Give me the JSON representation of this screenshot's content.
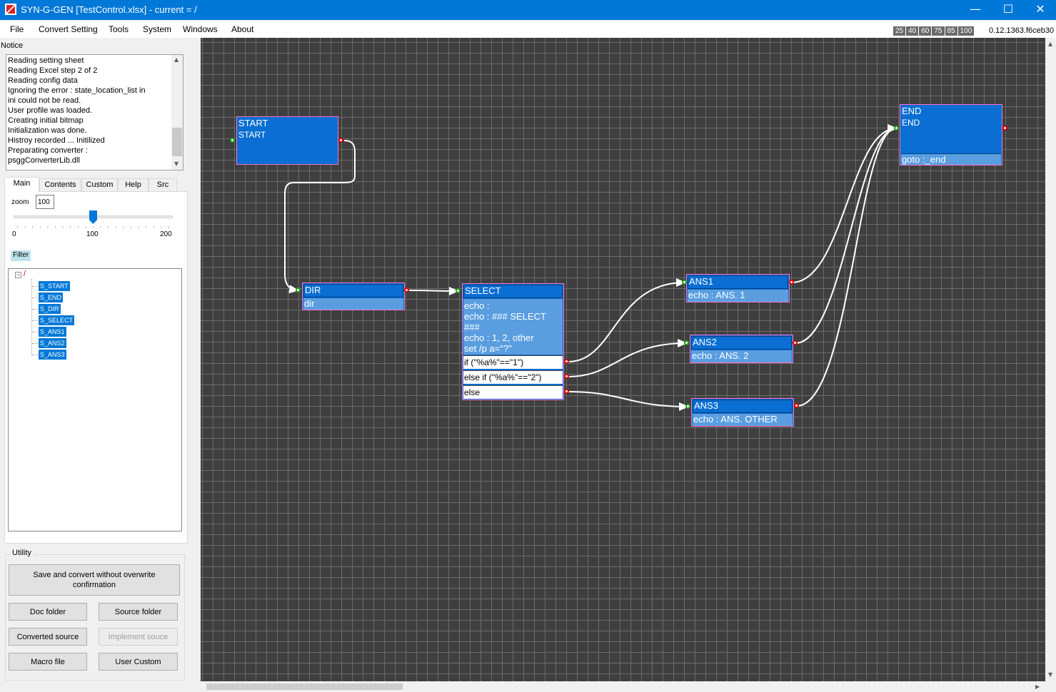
{
  "window": {
    "title": "SYN-G-GEN  [TestControl.xlsx] - current = /",
    "minimize": "—",
    "maximize": "☐",
    "close": "✕"
  },
  "menu": [
    "File",
    "Convert Setting",
    "Tools",
    "System",
    "Windows",
    "About"
  ],
  "zoom_presets": [
    "25",
    "40",
    "60",
    "75",
    "85",
    "100"
  ],
  "version": "0.12.1363.f6ceb30",
  "notice": {
    "label": "Notice",
    "lines": [
      "Reading setting sheet",
      "Reading Excel step 2 of 2",
      "Reading config data",
      "Ignoring the error : state_location_list in",
      "ini could not be read.",
      "User profile was loaded.",
      "Creating initial bitmap",
      "Initialization was done.",
      "Histroy recorded ... Initilized",
      "Preparating converter :",
      "psggConverterLib.dll"
    ]
  },
  "tabs": [
    "Main",
    "Contents",
    "Custom",
    "Help",
    "Src"
  ],
  "zoom": {
    "label": "zoom",
    "value": "100",
    "level": 100,
    "min_label": "0",
    "mid_label": "100",
    "max_label": "200"
  },
  "filter_label": "Filter",
  "tree": {
    "expander": "−",
    "root": "/",
    "items": [
      "S_START",
      "S_END",
      "S_DIR",
      "S_SELECT",
      "S_ANS1",
      "S_ANS2",
      "S_ANS3"
    ]
  },
  "utility": {
    "label": "Utility",
    "save_convert": "Save and convert without overwrite confirmation",
    "doc_folder": "Doc folder",
    "source_folder": "Source folder",
    "converted_source": "Converted source",
    "implement_source": "Implement souce",
    "macro_file": "Macro file",
    "user_custom": "User Custom"
  },
  "nodes": {
    "start": {
      "title": "START",
      "sub": "START"
    },
    "end": {
      "title": "END",
      "sub": "END",
      "body": "goto :_end"
    },
    "dir": {
      "title": "DIR",
      "body": "dir"
    },
    "select": {
      "title": "SELECT",
      "body": [
        "echo :",
        "echo : ### SELECT",
        "###",
        "echo : 1, 2, other",
        "set /p a=\"?\""
      ],
      "branches": [
        "if (\"%a%\"==\"1\")",
        "else if (\"%a%\"==\"2\")",
        "else"
      ]
    },
    "ans1": {
      "title": "ANS1",
      "body": "echo : ANS. 1"
    },
    "ans2": {
      "title": "ANS2",
      "body": "echo : ANS. 2"
    },
    "ans3": {
      "title": "ANS3",
      "body": "echo : ANS. OTHER"
    }
  },
  "colors": {
    "titlebar": "#0078d7",
    "canvas_bg": "#3f3f3f",
    "grid": "#6b6b6b",
    "node_head": "#0a6ed2",
    "node_body": "#5a9ee0",
    "node_border": "#ff6ec7",
    "port_in": "#1fa01f",
    "port_out": "#e00000"
  }
}
